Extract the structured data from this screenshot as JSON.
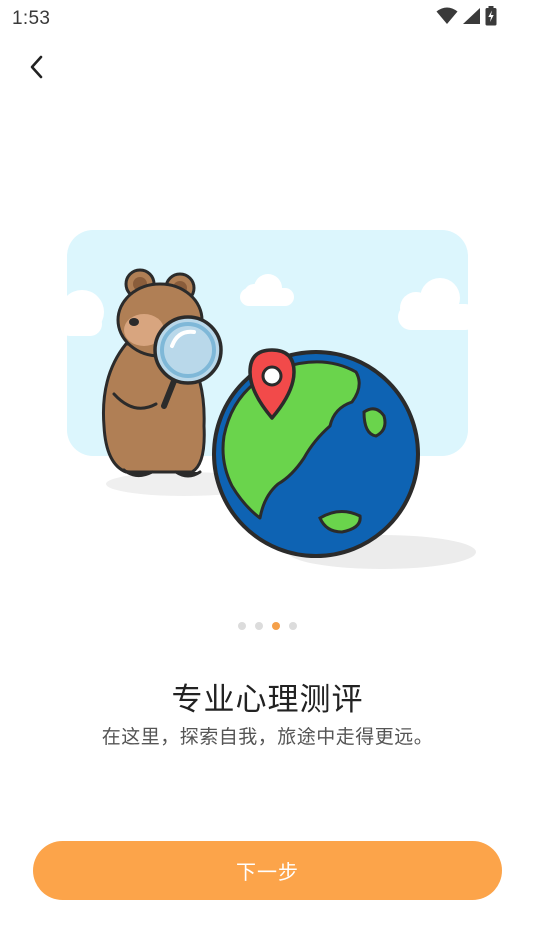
{
  "status_bar": {
    "time": "1:53",
    "icons": [
      "wifi-icon",
      "signal-icon",
      "battery-charging-icon"
    ]
  },
  "nav": {
    "back_icon": "chevron-left-icon"
  },
  "illustration": {
    "description_icon": "bear-magnifier-globe-illustration"
  },
  "pager": {
    "total": 4,
    "active_index": 2
  },
  "content": {
    "title": "专业心理测评",
    "subtitle": "在这里，探索自我，旅途中走得更远。"
  },
  "actions": {
    "next_label": "下一步"
  },
  "colors": {
    "accent": "#fca44a",
    "dot_active": "#f5a04a",
    "dot_inactive": "#dcdcdc",
    "sky": "#dcf6fd",
    "globe_ocean": "#0e63b3",
    "globe_land": "#6ad44c",
    "pin": "#f24a4a",
    "bear": "#b07f55"
  }
}
